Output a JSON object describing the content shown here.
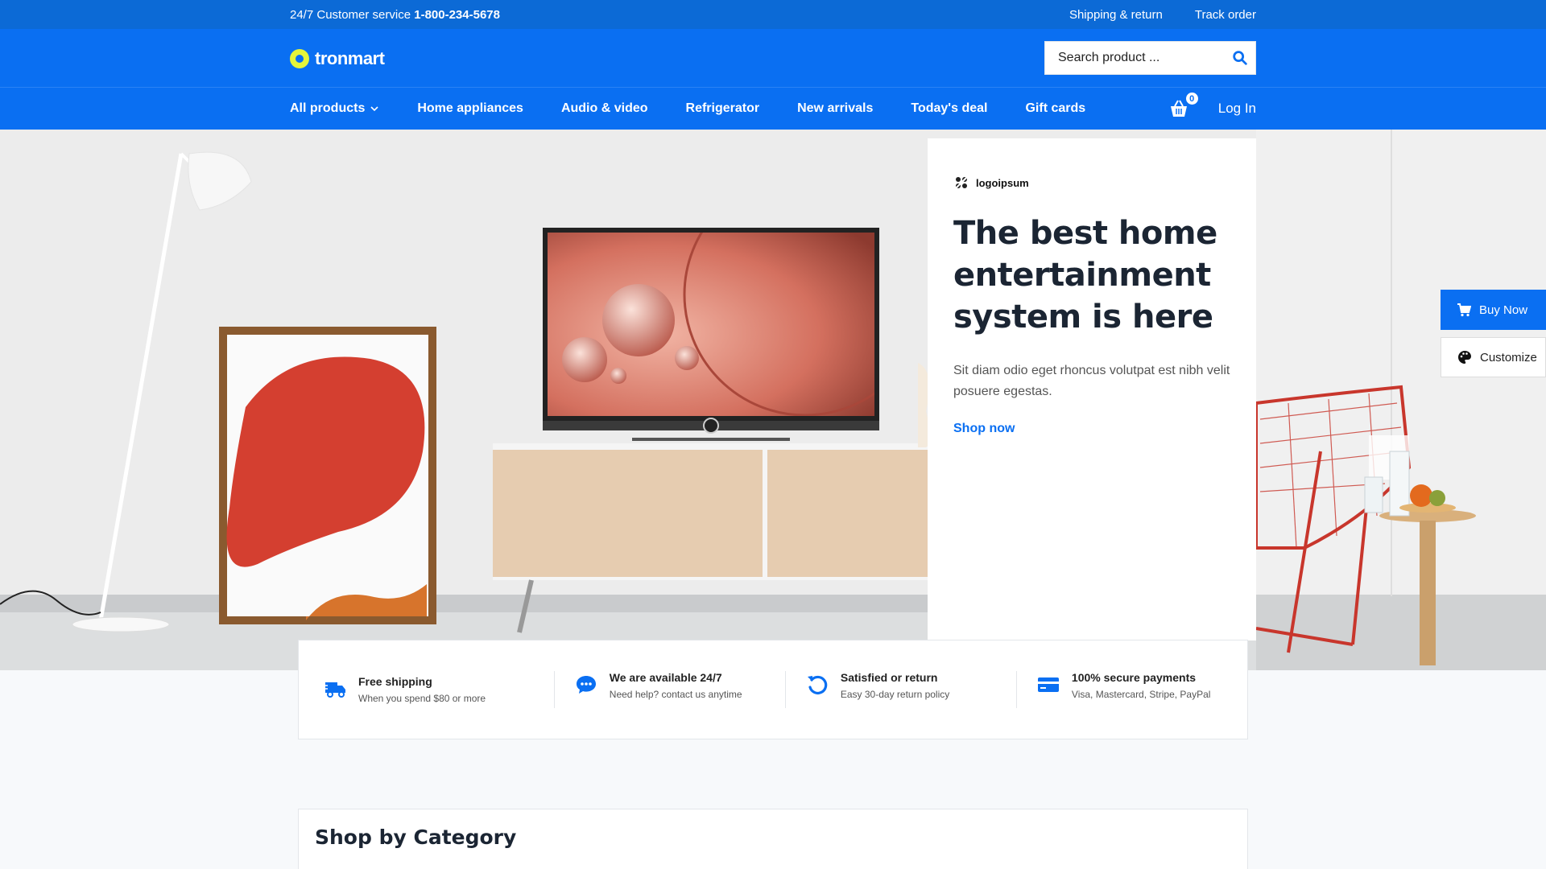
{
  "topbar": {
    "customer_service_label": "24/7 Customer service",
    "phone": "1-800-234-5678",
    "links": [
      "Shipping & return",
      "Track order"
    ]
  },
  "header": {
    "logo_text": "tronmart",
    "search_placeholder": "Search product ..."
  },
  "nav": {
    "items": [
      "All products",
      "Home appliances",
      "Audio & video",
      "Refrigerator",
      "New arrivals",
      "Today's deal",
      "Gift cards"
    ],
    "cart_count": "0",
    "login_label": "Log In"
  },
  "hero": {
    "brand_logo": "logoipsum",
    "headline": "The best home entertainment system is here",
    "description": "Sit diam odio eget rhoncus volutpat est nibh velit posuere egestas.",
    "cta": "Shop now"
  },
  "floating": {
    "buy_label": "Buy Now",
    "customize_label": "Customize"
  },
  "features": [
    {
      "icon": "truck-icon",
      "title": "Free shipping",
      "subtitle": "When you spend $80 or more"
    },
    {
      "icon": "chat-icon",
      "title": "We are available 24/7",
      "subtitle": "Need help? contact us anytime"
    },
    {
      "icon": "return-icon",
      "title": "Satisfied or return",
      "subtitle": "Easy 30-day return policy"
    },
    {
      "icon": "credit-card-icon",
      "title": "100% secure payments",
      "subtitle": "Visa, Mastercard, Stripe, PayPal"
    }
  ],
  "category": {
    "title": "Shop by Category"
  },
  "colors": {
    "primary": "#0a6ff2",
    "topbar": "#0c6ad6",
    "logo_accent": "#e5f53a",
    "heading": "#1b2533"
  }
}
